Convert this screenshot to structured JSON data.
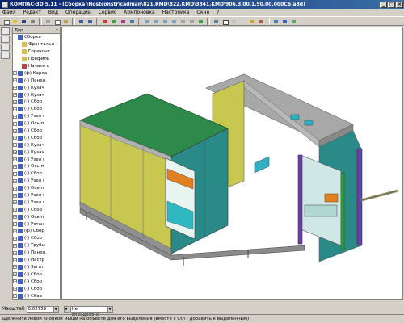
{
  "window": {
    "title": "КОМПАС-3D 5.11 - [Сборка \\Hostconstr\\cadman\\821.KMD\\822.KMD\\3841.KMD\\906.3.00.1.50.00.000СБ.a3d]",
    "min": "_",
    "max": "□",
    "close": "×"
  },
  "menu": [
    "Файл",
    "Редакт",
    "Вид",
    "Операции",
    "Сервис",
    "Компоновка",
    "Настройка",
    "Окно",
    "?"
  ],
  "tree": {
    "header": "Дер.",
    "close": "x",
    "items": [
      {
        "label": "Сборка",
        "expander": "",
        "icon": "#4060c0"
      },
      {
        "label": "Фронтальн",
        "expander": "",
        "icon": "#d8c040"
      },
      {
        "label": "Горизонт.",
        "expander": "",
        "icon": "#d8c040"
      },
      {
        "label": "Профиль",
        "expander": "",
        "icon": "#d8c040"
      },
      {
        "label": "Начало к",
        "expander": "",
        "icon": "#c04040"
      },
      {
        "label": "(ф) Карка",
        "expander": "+",
        "icon": "#4060c0"
      },
      {
        "label": "(-) Панел.",
        "expander": "+",
        "icon": "#4060c0"
      },
      {
        "label": "(-) Кузач",
        "expander": "+",
        "icon": "#4060c0"
      },
      {
        "label": "(-) Кузач",
        "expander": "+",
        "icon": "#4060c0"
      },
      {
        "label": "(-) Сбор",
        "expander": "+",
        "icon": "#4060c0"
      },
      {
        "label": "(-) Сбор",
        "expander": "+",
        "icon": "#4060c0"
      },
      {
        "label": "(-) Узел (",
        "expander": "+",
        "icon": "#4060c0"
      },
      {
        "label": "(-) Ось-п",
        "expander": "+",
        "icon": "#4060c0"
      },
      {
        "label": "(-) Сбор",
        "expander": "+",
        "icon": "#4060c0"
      },
      {
        "label": "(-) Сбор",
        "expander": "+",
        "icon": "#4060c0"
      },
      {
        "label": "(-) Кузач",
        "expander": "+",
        "icon": "#4060c0"
      },
      {
        "label": "(-) Кузач",
        "expander": "+",
        "icon": "#4060c0"
      },
      {
        "label": "(-) Узел (",
        "expander": "+",
        "icon": "#4060c0"
      },
      {
        "label": "(-) Ось-п",
        "expander": "+",
        "icon": "#4060c0"
      },
      {
        "label": "(-) Сбор",
        "expander": "+",
        "icon": "#4060c0"
      },
      {
        "label": "(-) Узел (",
        "expander": "+",
        "icon": "#4060c0"
      },
      {
        "label": "(-) Ось-п",
        "expander": "+",
        "icon": "#4060c0"
      },
      {
        "label": "(-) Узел (",
        "expander": "+",
        "icon": "#4060c0"
      },
      {
        "label": "(-) Узел (",
        "expander": "+",
        "icon": "#4060c0"
      },
      {
        "label": "(-) Сбор",
        "expander": "+",
        "icon": "#4060c0"
      },
      {
        "label": "(-) Ось-п",
        "expander": "+",
        "icon": "#4060c0"
      },
      {
        "label": "(-) Устан",
        "expander": "+",
        "icon": "#4060c0"
      },
      {
        "label": "(ф) Сбор",
        "expander": "+",
        "icon": "#4060c0"
      },
      {
        "label": "(-) Сбор",
        "expander": "+",
        "icon": "#4060c0"
      },
      {
        "label": "(-) Трубы",
        "expander": "+",
        "icon": "#4060c0"
      },
      {
        "label": "(-) Панел.",
        "expander": "+",
        "icon": "#4060c0"
      },
      {
        "label": "(-) Настр",
        "expander": "+",
        "icon": "#4060c0"
      },
      {
        "label": "(-) Загот",
        "expander": "+",
        "icon": "#4060c0"
      },
      {
        "label": "(-) Сбор",
        "expander": "+",
        "icon": "#4060c0"
      },
      {
        "label": "(-) Сбор",
        "expander": "+",
        "icon": "#4060c0"
      },
      {
        "label": "(-) Сбор",
        "expander": "+",
        "icon": "#4060c0"
      },
      {
        "label": "(-) Сбор",
        "expander": "+",
        "icon": "#4060c0"
      }
    ]
  },
  "status": {
    "scale_label": "Масштаб",
    "scale_value": "0.02759",
    "mode_value": "Не определена",
    "hint": "Щелкните левой кнопкой мыши на объекте для его выделения (вместе с Ctrl - добавить к выделенным)"
  },
  "colors": {
    "green_panel": "#2e8a4a",
    "yellow_panel": "#c8c850",
    "teal_panel": "#2a8a88",
    "grey_frame": "#b0b0b0",
    "purple_post": "#6a40a0",
    "orange": "#e08020"
  }
}
